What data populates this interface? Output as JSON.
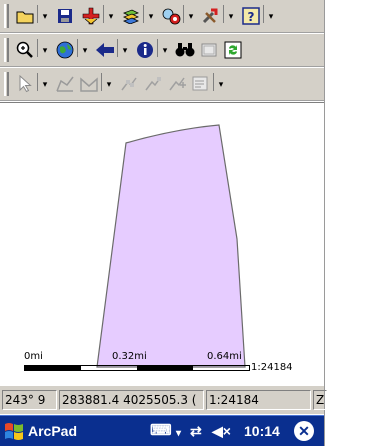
{
  "toolbars": {
    "row1": [
      {
        "name": "open-folder-icon",
        "glyph": "📂"
      },
      {
        "name": "save-icon",
        "glyph": "💾"
      },
      {
        "name": "add-data-icon",
        "glyph": "✚"
      },
      {
        "name": "layers-icon",
        "glyph": "≋"
      },
      {
        "name": "gps-icon",
        "glyph": "✲"
      },
      {
        "name": "tools-icon",
        "glyph": "⚒"
      },
      {
        "name": "help-icon",
        "glyph": "?"
      }
    ],
    "row2": [
      {
        "name": "zoom-in-icon",
        "glyph": "🔍"
      },
      {
        "name": "globe-icon",
        "glyph": "●"
      },
      {
        "name": "back-arrow-icon",
        "glyph": "◀"
      },
      {
        "name": "identify-icon",
        "glyph": "i"
      },
      {
        "name": "find-binoculars-icon",
        "glyph": "⌕"
      },
      {
        "name": "table-icon",
        "glyph": "▦"
      },
      {
        "name": "refresh-icon",
        "glyph": "⟳"
      }
    ],
    "row3": [
      {
        "name": "select-pointer-icon",
        "glyph": "↖"
      },
      {
        "name": "edit-polygon-icon",
        "glyph": "⌒"
      },
      {
        "name": "vertex-tools-icon",
        "glyph": "✧"
      },
      {
        "name": "feature-properties-icon",
        "glyph": "▤"
      }
    ]
  },
  "map": {
    "polygon_fill": "#e6ccff",
    "scale": {
      "label_start": "0mi",
      "label_mid": "0.32mi",
      "label_end": "0.64mi",
      "ratio": "1:24184"
    }
  },
  "status": {
    "bearing": "243° 9",
    "coords": "283881.4 4025505.3 (",
    "scale": "1:24184",
    "extra": "Z"
  },
  "taskbar": {
    "app_title": "ArcPad",
    "keyboard_icon": "⌨",
    "network_icon": "⇄",
    "volume_icon": "◀×",
    "time": "10:14",
    "close_label": "✕"
  }
}
